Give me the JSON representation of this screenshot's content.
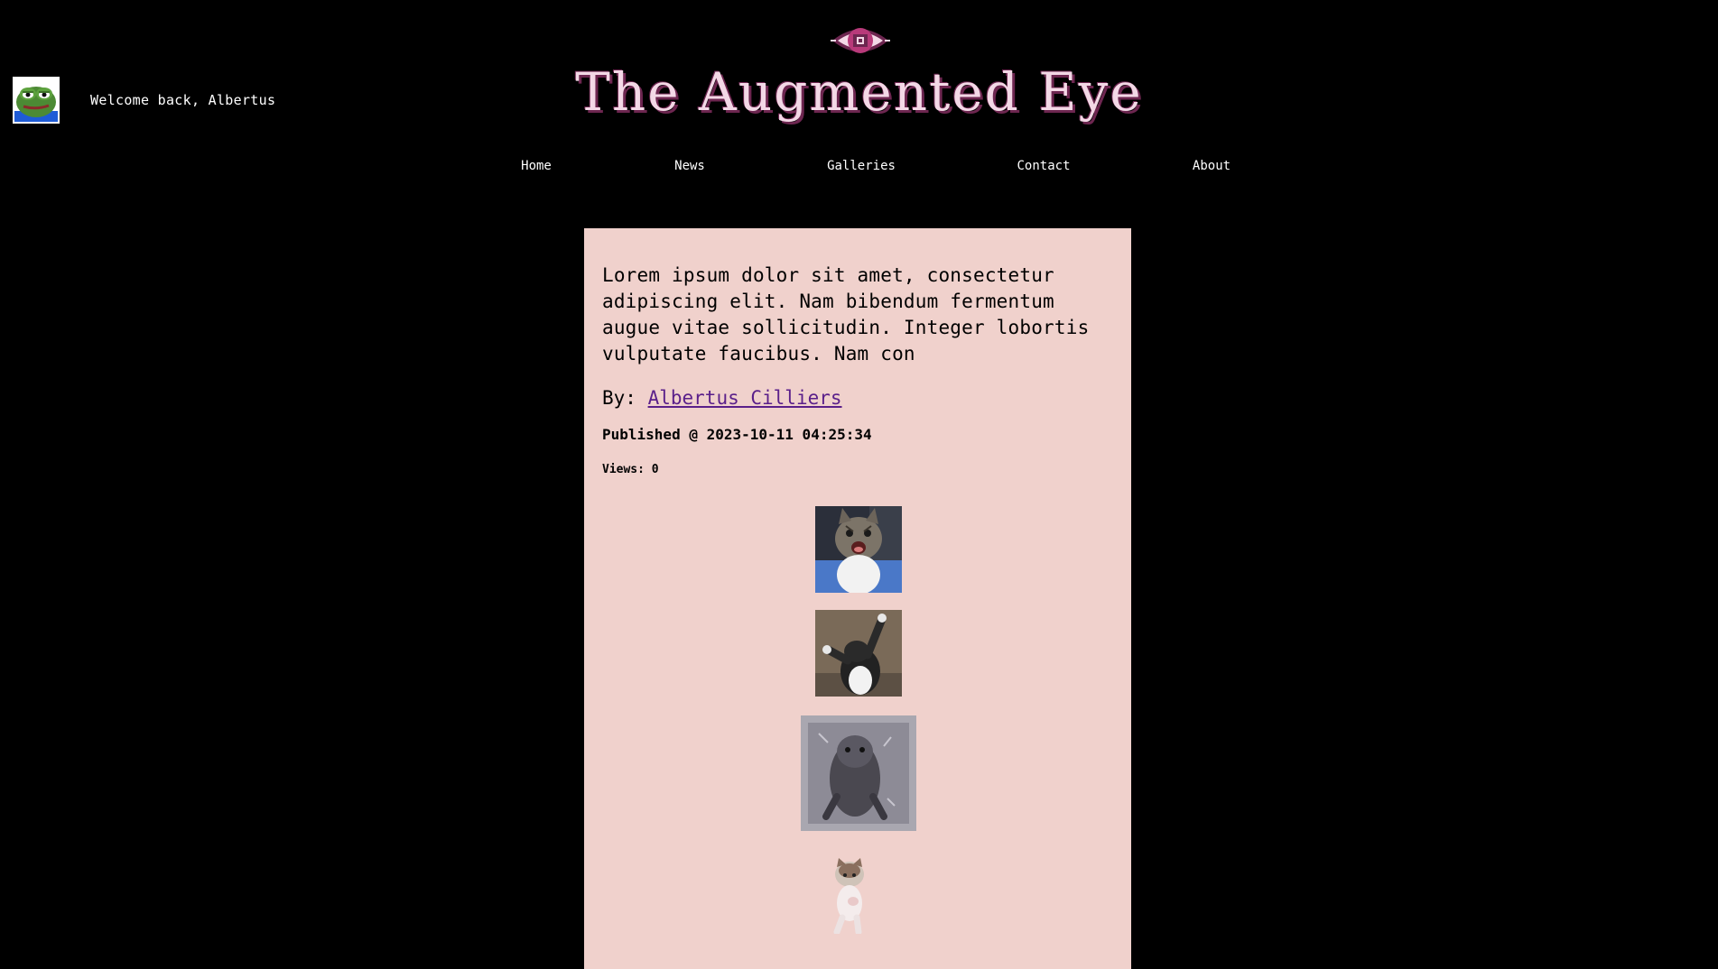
{
  "user": {
    "welcome_text": "Welcome back, Albertus",
    "avatar_icon": "frog-avatar-icon"
  },
  "header": {
    "logo_icon": "eye-logo-icon",
    "title": "The Augmented Eye",
    "title_color": "#f3d8e6",
    "title_shadow_color": "#6d2650"
  },
  "nav": {
    "items": [
      {
        "label": "Home"
      },
      {
        "label": "News"
      },
      {
        "label": "Galleries"
      },
      {
        "label": "Contact"
      },
      {
        "label": "About"
      }
    ]
  },
  "article": {
    "title": "Lorem ipsum dolor sit amet, consectetur adipiscing elit. Nam bibendum fermentum augue vitae sollicitudin. Integer lobortis vulputate faucibus. Nam con",
    "by_prefix": "By:",
    "author": "Albertus Cilliers",
    "published": "Published @ 2023-10-11 04:25:34",
    "views": "Views: 0",
    "card_color": "#f0d1cc",
    "author_link_color": "#5a1f8a",
    "images": [
      {
        "name": "cat-image-1",
        "depicts": "laughing cat"
      },
      {
        "name": "cat-image-2",
        "depicts": "dancing cat"
      },
      {
        "name": "cat-image-3",
        "depicts": "wet cat"
      },
      {
        "name": "cat-image-4",
        "depicts": "standing cat"
      }
    ]
  }
}
